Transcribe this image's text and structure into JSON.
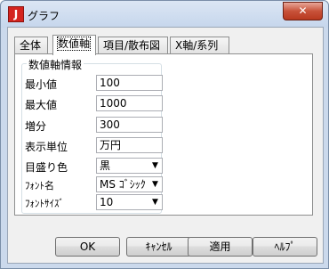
{
  "window": {
    "icon_letter": "J",
    "title": "グラフ",
    "close_glyph": "✕"
  },
  "tabs": [
    {
      "label": "全体"
    },
    {
      "label": "数値軸"
    },
    {
      "label": "項目/散布図"
    },
    {
      "label": "X軸/系列"
    }
  ],
  "active_tab": "数値軸",
  "group": {
    "title": "数値軸情報",
    "fields": {
      "min": {
        "label": "最小値",
        "value": "100"
      },
      "max": {
        "label": "最大値",
        "value": "1000"
      },
      "step": {
        "label": "増分",
        "value": "300"
      },
      "unit": {
        "label": "表示単位",
        "value": "万円"
      },
      "tick_color": {
        "label": "目盛り色",
        "value": "黒"
      },
      "font_name": {
        "label": "ﾌｫﾝﾄ名",
        "value": "MS ｺﾞｼｯｸ"
      },
      "font_size": {
        "label": "ﾌｫﾝﾄｻｲｽﾞ",
        "value": "10"
      }
    }
  },
  "buttons": {
    "ok": "OK",
    "cancel": "ｷｬﾝｾﾙ",
    "apply": "適用",
    "help": "ﾍﾙﾌﾟ"
  },
  "icons": {
    "dropdown": "chevron-down-icon",
    "app": "app-icon",
    "close": "close-icon"
  }
}
